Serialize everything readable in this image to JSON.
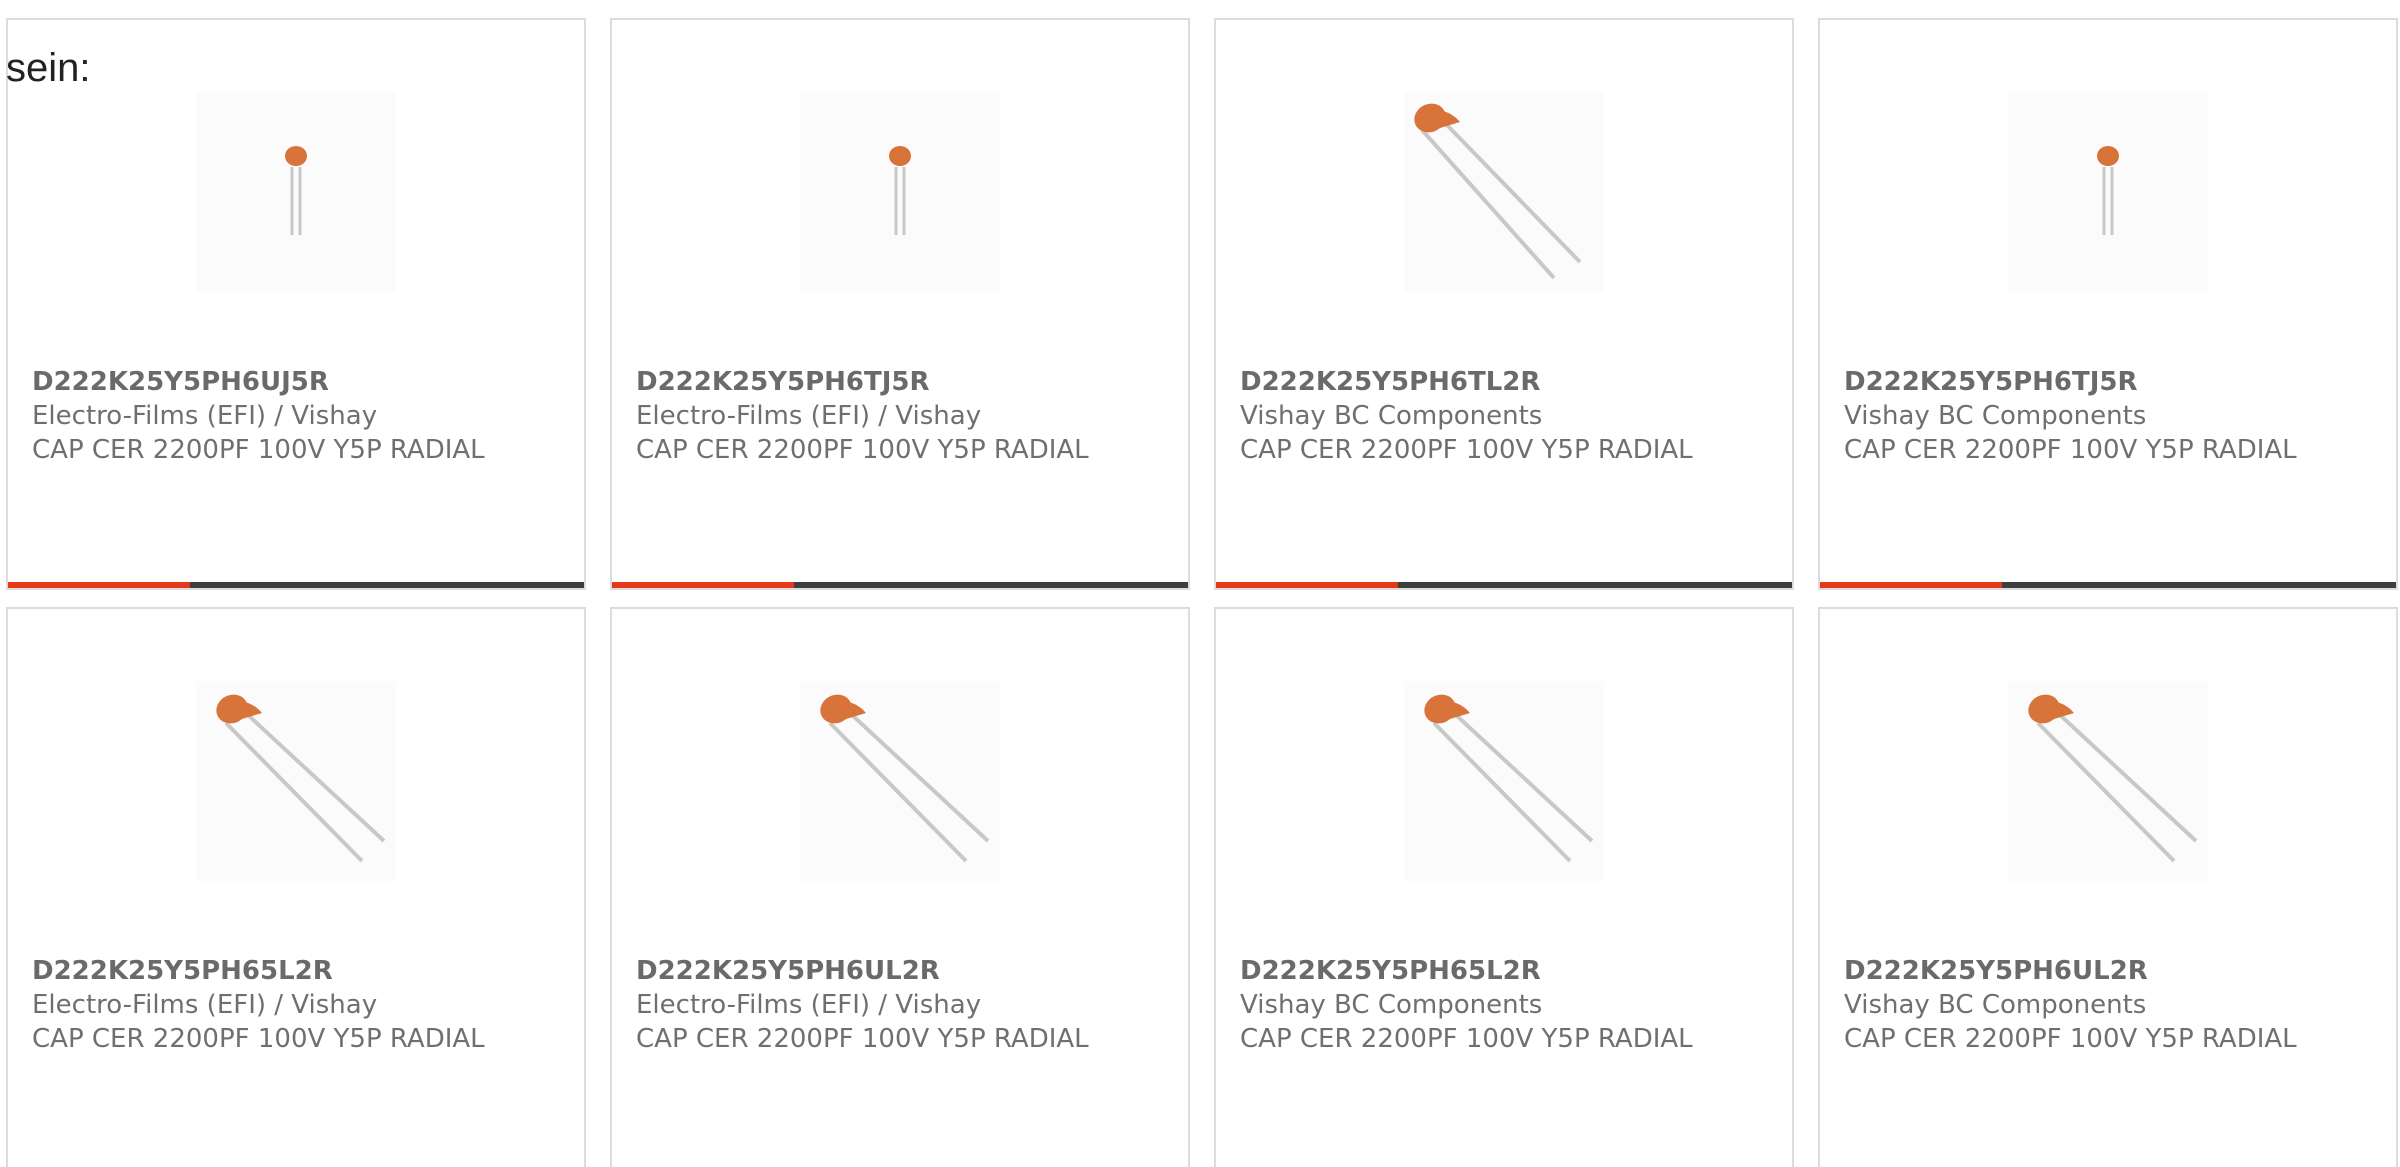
{
  "page_text": "sein:",
  "colors": {
    "accent": "#e8381a",
    "bar": "#3e3e3e",
    "card_border": "#dcdcdc",
    "capacitor_body": "#d8743a",
    "lead": "#c8c8c8"
  },
  "products": [
    {
      "part_number": "D222K25Y5PH6UJ5R",
      "manufacturer": "Electro-Films (EFI) / Vishay",
      "description": "CAP CER 2200PF 100V Y5P RADIAL",
      "image_icon": "capacitor-upright-icon"
    },
    {
      "part_number": "D222K25Y5PH6TJ5R",
      "manufacturer": "Electro-Films (EFI) / Vishay",
      "description": "CAP CER 2200PF 100V Y5P RADIAL",
      "image_icon": "capacitor-upright-icon"
    },
    {
      "part_number": "D222K25Y5PH6TL2R",
      "manufacturer": "Vishay BC Components",
      "description": "CAP CER 2200PF 100V Y5P RADIAL",
      "image_icon": "capacitor-angled-icon"
    },
    {
      "part_number": "D222K25Y5PH6TJ5R",
      "manufacturer": "Vishay BC Components",
      "description": "CAP CER 2200PF 100V Y5P RADIAL",
      "image_icon": "capacitor-upright-icon"
    },
    {
      "part_number": "D222K25Y5PH65L2R",
      "manufacturer": "Electro-Films (EFI) / Vishay",
      "description": "CAP CER 2200PF 100V Y5P RADIAL",
      "image_icon": "capacitor-angled-icon"
    },
    {
      "part_number": "D222K25Y5PH6UL2R",
      "manufacturer": "Electro-Films (EFI) / Vishay",
      "description": "CAP CER 2200PF 100V Y5P RADIAL",
      "image_icon": "capacitor-angled-icon"
    },
    {
      "part_number": "D222K25Y5PH65L2R",
      "manufacturer": "Vishay BC Components",
      "description": "CAP CER 2200PF 100V Y5P RADIAL",
      "image_icon": "capacitor-angled-icon"
    },
    {
      "part_number": "D222K25Y5PH6UL2R",
      "manufacturer": "Vishay BC Components",
      "description": "CAP CER 2200PF 100V Y5P RADIAL",
      "image_icon": "capacitor-angled-icon"
    }
  ]
}
